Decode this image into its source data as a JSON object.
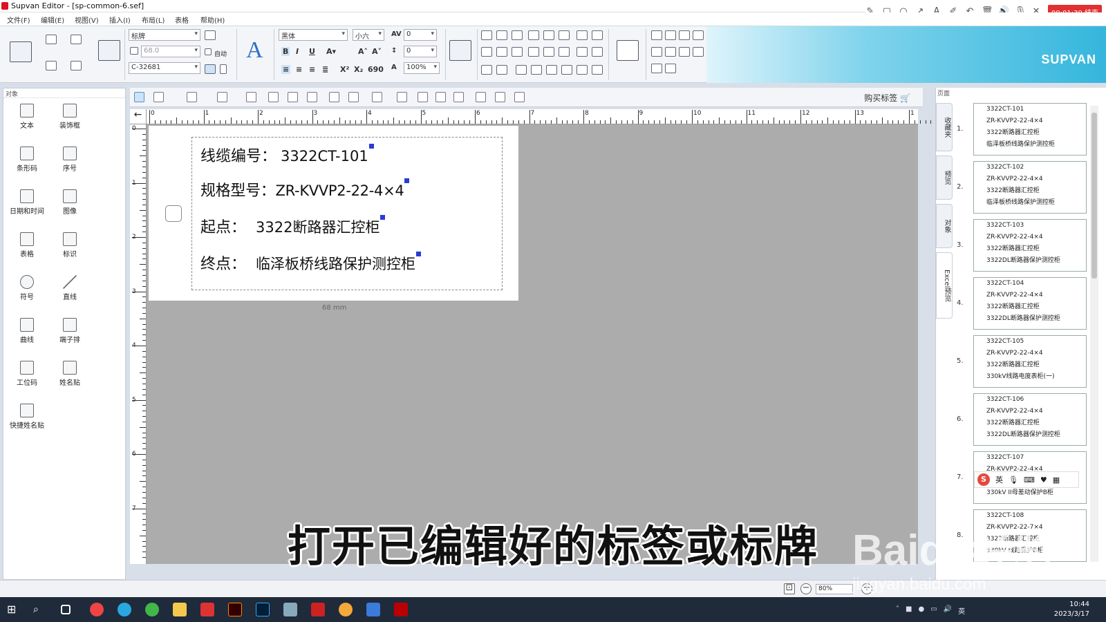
{
  "window": {
    "title": "Supvan Editor - [sp-common-6.sef]"
  },
  "menu": [
    "文件(F)",
    "编辑(E)",
    "视图(V)",
    "插入(I)",
    "布局(L)",
    "表格",
    "帮助(H)"
  ],
  "recorder": {
    "stop_label": "00:01:30 结束"
  },
  "ribbon": {
    "template_select": "标牌",
    "width_value": "68.0",
    "auto_label": "自动",
    "model_select": "C-32681",
    "font_select": "黑体",
    "size_select": "小六",
    "spacing_1": "0",
    "spacing_2": "0",
    "scale_select": "100%",
    "number_690": "690",
    "brand": "SUPVAN"
  },
  "left_panel": {
    "header": "对象",
    "tools": [
      "文本",
      "装饰框",
      "条形码",
      "序号",
      "日期和时间",
      "图像",
      "表格",
      "标识",
      "符号",
      "直线",
      "曲线",
      "端子排",
      "工位码",
      "姓名贴",
      "快捷姓名贴"
    ]
  },
  "toolbar2": {
    "buy_label": "购买标签"
  },
  "ruler": {
    "h": [
      "0",
      "1",
      "2",
      "3",
      "4",
      "5",
      "6",
      "7",
      "8",
      "9",
      "10",
      "11",
      "12",
      "13",
      "1"
    ],
    "v": [
      "0",
      "1",
      "2",
      "3",
      "4",
      "5",
      "6",
      "7"
    ]
  },
  "label": {
    "rows": [
      {
        "key": "线缆编号：",
        "value": "3322CT-101"
      },
      {
        "key": "规格型号：",
        "value": "ZR-KVVP2-22-4×4"
      },
      {
        "key": "起点：",
        "value": "3322断路器汇控柜"
      },
      {
        "key": "终点：",
        "value": "临泽板桥线路保护测控柜"
      }
    ],
    "dimension": "68 mm"
  },
  "right_panel": {
    "header": "页面",
    "tabs": [
      "收藏夹",
      "预览",
      "对象",
      "Excel预览"
    ],
    "pages": [
      {
        "num": "1.",
        "lines": [
          "3322CT-101",
          "ZR-KVVP2-22-4×4",
          "3322断路器汇控柜",
          "临泽板桥线路保护测控柜"
        ]
      },
      {
        "num": "2.",
        "lines": [
          "3322CT-102",
          "ZR-KVVP2-22-4×4",
          "3322断路器汇控柜",
          "临泽板桥线路保护测控柜"
        ]
      },
      {
        "num": "3.",
        "lines": [
          "3322CT-103",
          "ZR-KVVP2-22-4×4",
          "3322断路器汇控柜",
          "3322DL断路器保护测控柜"
        ]
      },
      {
        "num": "4.",
        "lines": [
          "3322CT-104",
          "ZR-KVVP2-22-4×4",
          "3322断路器汇控柜",
          "3322DL断路器保护测控柜"
        ]
      },
      {
        "num": "5.",
        "lines": [
          "3322CT-105",
          "ZR-KVVP2-22-4×4",
          "3322断路器汇控柜",
          "330kV线路电度表柜(一)"
        ]
      },
      {
        "num": "6.",
        "lines": [
          "3322CT-106",
          "ZR-KVVP2-22-4×4",
          "3322断路器汇控柜",
          "3322DL断路器保护测控柜"
        ]
      },
      {
        "num": "7.",
        "lines": [
          "3322CT-107",
          "ZR-KVVP2-22-4×4",
          "3322断路器汇控柜",
          "330kV II母差动保护B柜"
        ]
      },
      {
        "num": "8.",
        "lines": [
          "3322CT-108",
          "ZR-KVVP2-22-7×4",
          "3322断路器汇控柜",
          "330kV 线路保护B柜"
        ]
      }
    ],
    "ime": "英"
  },
  "status": {
    "zoom": "80%"
  },
  "subtitle": "打开已编辑好的标签或标牌",
  "watermark": {
    "main": "Baidu经验",
    "url": "jingyan.baidu.com"
  },
  "taskbar": {
    "time": "10:44",
    "date": "2023/3/17",
    "ime": "英"
  }
}
